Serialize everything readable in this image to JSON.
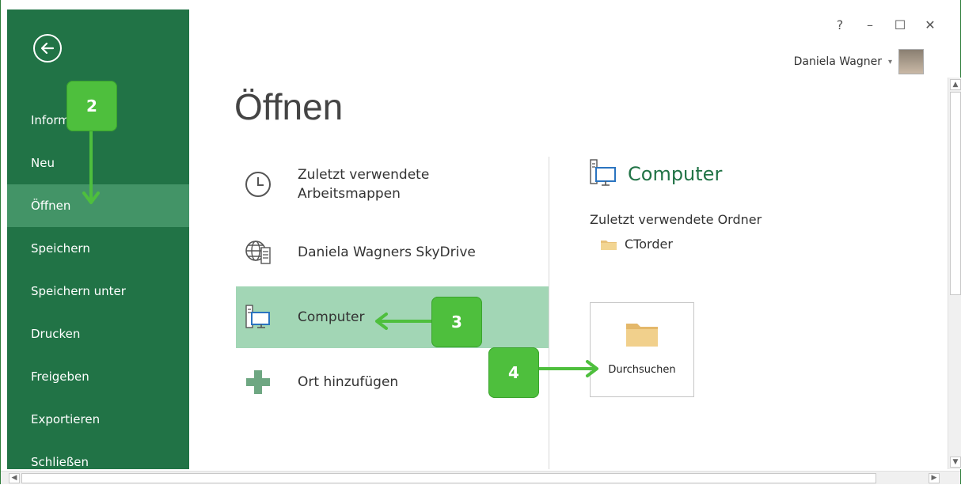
{
  "window": {
    "help": "?",
    "minimize": "–",
    "maximize": "☐",
    "close": "✕",
    "user_name": "Daniela Wagner",
    "user_caret": "▾"
  },
  "sidebar": {
    "bg_color": "#217346",
    "selected_color": "#439467",
    "items": [
      {
        "label": "Informationen"
      },
      {
        "label": "Neu"
      },
      {
        "label": "Öffnen",
        "selected": true
      },
      {
        "label": "Speichern"
      },
      {
        "label": "Speichern unter"
      },
      {
        "label": "Drucken"
      },
      {
        "label": "Freigeben"
      },
      {
        "label": "Exportieren"
      },
      {
        "label": "Schließen"
      }
    ]
  },
  "main": {
    "title": "Öffnen",
    "places": [
      {
        "icon": "clock-icon",
        "label": "Zuletzt verwendete\nArbeitsmappen"
      },
      {
        "icon": "skydrive-globe-icon",
        "label": "Daniela Wagners SkyDrive"
      },
      {
        "icon": "computer-icon",
        "label": "Computer",
        "selected": true
      },
      {
        "icon": "plus-icon",
        "label": "Ort hinzufügen"
      }
    ],
    "right_panel": {
      "title": "Computer",
      "recent_folders_label": "Zuletzt verwendete Ordner",
      "recent_folders": [
        "CTorder"
      ],
      "browse_label": "Durchsuchen"
    }
  },
  "annotations": {
    "color": "#4ebf3d",
    "badges": [
      "2",
      "3",
      "4"
    ]
  }
}
